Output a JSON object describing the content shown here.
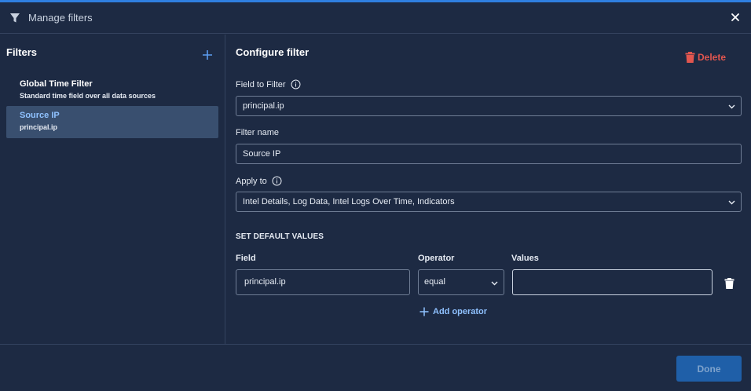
{
  "header": {
    "title": "Manage filters",
    "close_icon": "close-icon"
  },
  "sidebar": {
    "title": "Filters",
    "items": [
      {
        "name": "Global Time Filter",
        "description": "Standard time field over all data sources",
        "selected": false
      },
      {
        "name": "Source IP",
        "description": "principal.ip",
        "selected": true
      }
    ]
  },
  "main": {
    "title": "Configure filter",
    "delete_label": "Delete",
    "field_to_filter": {
      "label": "Field to Filter",
      "value": "principal.ip"
    },
    "filter_name": {
      "label": "Filter name",
      "value": "Source IP"
    },
    "apply_to": {
      "label": "Apply to",
      "value": "Intel Details, Log Data, Intel Logs Over Time, Indicators"
    },
    "defaults": {
      "section_title": "SET DEFAULT VALUES",
      "columns": {
        "field": "Field",
        "operator": "Operator",
        "values": "Values"
      },
      "row": {
        "field": "principal.ip",
        "operator": "equal",
        "values": ""
      },
      "add_operator_label": "Add operator"
    }
  },
  "footer": {
    "done_label": "Done"
  },
  "colors": {
    "accent": "#2f7fe0",
    "delete": "#e2564f",
    "link": "#8fc1ff",
    "background": "#1d2a43"
  }
}
